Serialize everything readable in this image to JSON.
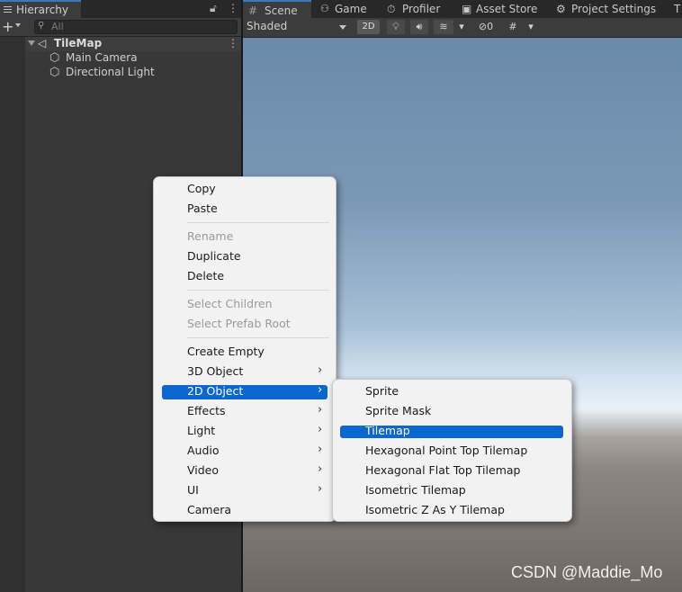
{
  "hierarchy": {
    "tab_label": "Hierarchy",
    "lock_icon": "lock-icon",
    "more_icon": "more-vertical-icon",
    "add_label": "+",
    "search_placeholder": "All",
    "scene_name": "TileMap",
    "children": [
      "Main Camera",
      "Directional Light"
    ]
  },
  "scene_tabs": [
    "Scene",
    "Game",
    "Profiler",
    "Asset Store",
    "Project Settings",
    "T"
  ],
  "scene_toolbar": {
    "draw_mode": "Shaded",
    "btn_2d": "2D",
    "hidden_count": "0"
  },
  "context_menu": {
    "items": [
      {
        "label": "Copy",
        "enabled": true
      },
      {
        "label": "Paste",
        "enabled": true
      },
      {
        "label": "Rename",
        "enabled": false
      },
      {
        "label": "Duplicate",
        "enabled": true
      },
      {
        "label": "Delete",
        "enabled": true
      },
      {
        "label": "Select Children",
        "enabled": false
      },
      {
        "label": "Select Prefab Root",
        "enabled": false
      },
      {
        "label": "Create Empty",
        "enabled": true
      },
      {
        "label": "3D Object",
        "enabled": true,
        "submenu": true
      },
      {
        "label": "2D Object",
        "enabled": true,
        "submenu": true,
        "highlighted": true
      },
      {
        "label": "Effects",
        "enabled": true,
        "submenu": true
      },
      {
        "label": "Light",
        "enabled": true,
        "submenu": true
      },
      {
        "label": "Audio",
        "enabled": true,
        "submenu": true
      },
      {
        "label": "Video",
        "enabled": true,
        "submenu": true
      },
      {
        "label": "UI",
        "enabled": true,
        "submenu": true
      },
      {
        "label": "Camera",
        "enabled": true
      }
    ]
  },
  "submenu_2d": {
    "items": [
      {
        "label": "Sprite"
      },
      {
        "label": "Sprite Mask"
      },
      {
        "label": "Tilemap",
        "highlighted": true
      },
      {
        "label": "Hexagonal Point Top Tilemap"
      },
      {
        "label": "Hexagonal Flat Top Tilemap"
      },
      {
        "label": "Isometric Tilemap"
      },
      {
        "label": "Isometric Z As Y Tilemap"
      }
    ]
  },
  "watermark": "CSDN @Maddie_Mo",
  "colors": {
    "highlight": "#0a67d0",
    "menu_bg": "#f2f2f2",
    "panel_bg": "#383838",
    "tab_accent": "#3a79bb"
  }
}
